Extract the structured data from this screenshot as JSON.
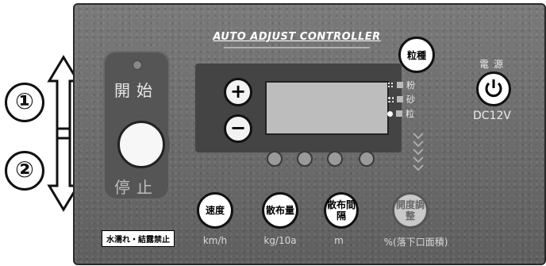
{
  "annotations": {
    "step1": "①",
    "step2": "②"
  },
  "start_stop": {
    "start_label": "開始",
    "stop_label": "停止",
    "warning_label": "水濡れ・結露禁止"
  },
  "brand": {
    "title": "AUTO ADJUST CONTROLLER"
  },
  "display": {
    "plus_label": "+",
    "minus_label": "−"
  },
  "functions": [
    {
      "label": "速度",
      "unit": "km/h"
    },
    {
      "label": "散布量",
      "unit": "kg/10a"
    },
    {
      "label": "散布間隔",
      "unit": "m"
    },
    {
      "label": "開度調整",
      "unit": "%(落下口面積)"
    }
  ],
  "seed": {
    "button_label": "粒種",
    "options": [
      "粉",
      "砂",
      "粒"
    ],
    "selected": "粒"
  },
  "power": {
    "title": "電源",
    "voltage": "DC12V"
  },
  "colors": {
    "panel": "#6f6f6f",
    "button_face": "#ffffff",
    "display": "#bdbdbd"
  }
}
